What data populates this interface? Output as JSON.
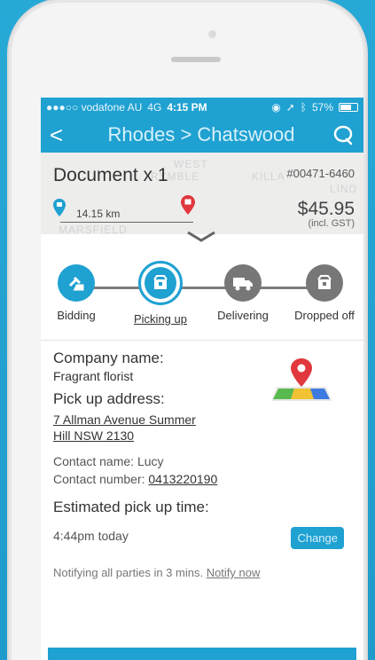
{
  "status_bar": {
    "carrier": "●●●○○ vodafone AU",
    "network": "4G",
    "time": "4:15 PM",
    "battery": "57%"
  },
  "nav": {
    "title": "Rhodes > Chatswood",
    "back_glyph": "<"
  },
  "order": {
    "title": "Document x 1",
    "number": "#00471-6460",
    "distance": "14.15 km",
    "price": "$45.95",
    "price_note": "(incl. GST)"
  },
  "map_bg_labels": [
    "WEST",
    "RYMBLE",
    "KILLA",
    "LIND",
    "MARSFIELD"
  ],
  "steps": [
    {
      "label": "Bidding",
      "state": "done",
      "icon": "gavel-icon"
    },
    {
      "label": "Picking up",
      "state": "current",
      "icon": "box-icon"
    },
    {
      "label": "Delivering",
      "state": "todo",
      "icon": "truck-icon"
    },
    {
      "label": "Dropped off",
      "state": "todo",
      "icon": "package-icon"
    }
  ],
  "details": {
    "company_heading": "Company name:",
    "company_value": "Fragrant florist",
    "address_heading": "Pick up address:",
    "address_line1": "7 Allman Avenue Summer",
    "address_line2": "Hill NSW 2130",
    "contact_name_label": "Contact name: Lucy",
    "contact_number_label": "Contact number: ",
    "contact_number": "0413220190",
    "pickup_heading": "Estimated pick up time:",
    "pickup_time": "4:44pm today",
    "change_label": "Change",
    "notify_text": "Notifying all parties in 3 mins. ",
    "notify_link": "Notify now"
  },
  "colors": {
    "accent": "#1fa1d1",
    "inactive": "#777777"
  }
}
